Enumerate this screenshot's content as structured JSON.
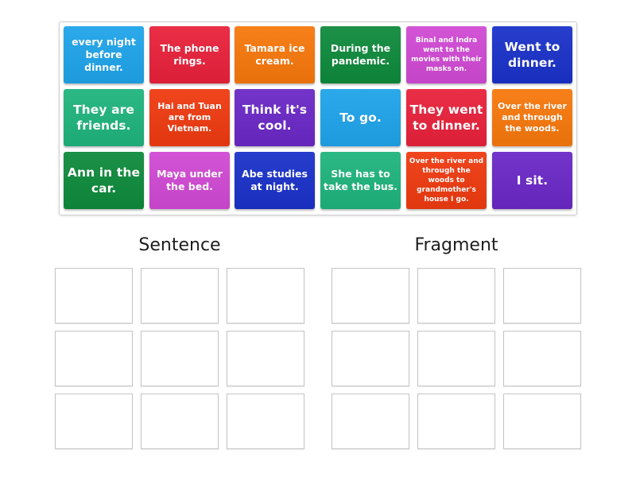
{
  "tray": {
    "cards": [
      {
        "text": "every night before dinner.",
        "color": "#1ea4ea",
        "size": "m"
      },
      {
        "text": "The phone rings.",
        "color": "#e8213b",
        "size": "m"
      },
      {
        "text": "Tamara ice cream.",
        "color": "#f7780c",
        "size": "m"
      },
      {
        "text": "During the pandemic.",
        "color": "#0e8a3c",
        "size": "m"
      },
      {
        "text": "Binal and Indra went to the movies with their masks on.",
        "color": "#d149d4",
        "size": "xs"
      },
      {
        "text": "Went to dinner.",
        "color": "#1a31c9",
        "size": "l"
      },
      {
        "text": "They are friends.",
        "color": "#1eb47d",
        "size": "l"
      },
      {
        "text": "Hai and Tuan are from Vietnam.",
        "color": "#ef3a10",
        "size": "s"
      },
      {
        "text": "Think it's cool.",
        "color": "#6a28c6",
        "size": "l"
      },
      {
        "text": "To go.",
        "color": "#1ea4ea",
        "size": "l"
      },
      {
        "text": "They went to dinner.",
        "color": "#e8213b",
        "size": "l"
      },
      {
        "text": "Over the river and through the woods.",
        "color": "#f7780c",
        "size": "s"
      },
      {
        "text": "Ann in the car.",
        "color": "#0e8a3c",
        "size": "l"
      },
      {
        "text": "Maya under the bed.",
        "color": "#d149d4",
        "size": "m"
      },
      {
        "text": "Abe studies at night.",
        "color": "#1a31c9",
        "size": "m"
      },
      {
        "text": "She has to take the bus.",
        "color": "#1eb47d",
        "size": "m"
      },
      {
        "text": "Over the river and through the woods to grandmother's house I go.",
        "color": "#ef3a10",
        "size": "xs"
      },
      {
        "text": "I sit.",
        "color": "#6a28c6",
        "size": "l"
      }
    ]
  },
  "categories": [
    {
      "title": "Sentence",
      "slots": 9
    },
    {
      "title": "Fragment",
      "slots": 9
    }
  ]
}
